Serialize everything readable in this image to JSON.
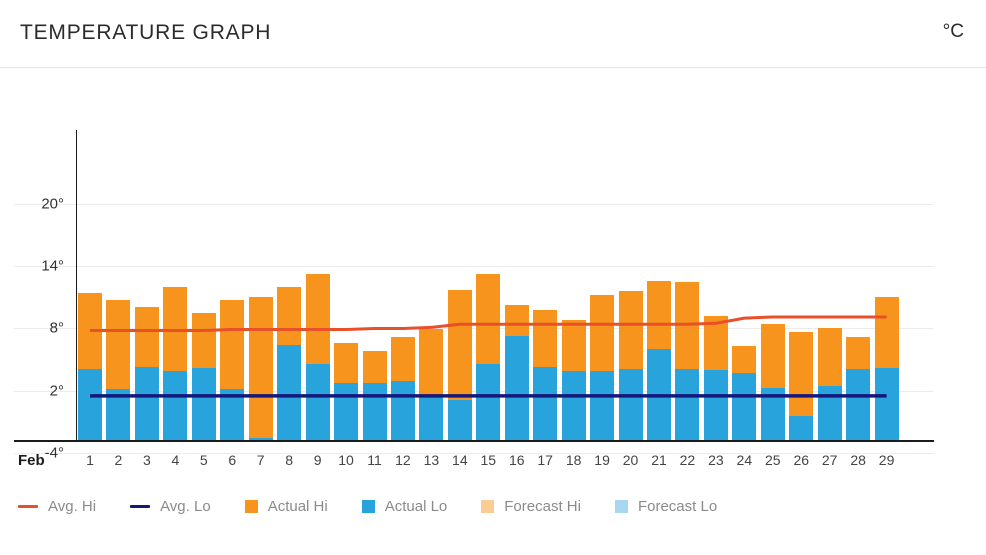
{
  "header": {
    "title": "TEMPERATURE GRAPH",
    "unit": "°C"
  },
  "axis": {
    "month_label": "Feb",
    "y_ticks": [
      "20°",
      "14°",
      "8°",
      "2°",
      "-4°"
    ],
    "x_labels": [
      "1",
      "2",
      "3",
      "4",
      "5",
      "6",
      "7",
      "8",
      "9",
      "10",
      "11",
      "12",
      "13",
      "14",
      "15",
      "16",
      "17",
      "18",
      "19",
      "20",
      "21",
      "22",
      "23",
      "24",
      "25",
      "26",
      "27",
      "28",
      "29"
    ]
  },
  "legend": {
    "items": [
      {
        "label": "Avg. Hi",
        "type": "line",
        "color": "#e8502a"
      },
      {
        "label": "Avg. Lo",
        "type": "line",
        "color": "#16177a"
      },
      {
        "label": "Actual Hi",
        "type": "box",
        "color": "#f7941e"
      },
      {
        "label": "Actual Lo",
        "type": "box",
        "color": "#29a3dc"
      },
      {
        "label": "Forecast Hi",
        "type": "box",
        "color": "#fbcd95"
      },
      {
        "label": "Forecast Lo",
        "type": "box",
        "color": "#a8d8ef"
      }
    ]
  },
  "colors": {
    "actual_hi": "#f7941e",
    "actual_lo": "#29a3dc",
    "forecast_hi": "#fbcd95",
    "forecast_lo": "#a8d8ef",
    "avg_hi": "#e8502a",
    "avg_lo": "#16177a",
    "grid": "#ececec",
    "axis": "#1b1b1b"
  },
  "chart_data": {
    "type": "bar",
    "title": "TEMPERATURE GRAPH",
    "xlabel": "Feb",
    "ylabel": "°C",
    "unit": "°C",
    "grid": true,
    "legend_position": "bottom-left",
    "ylim": [
      -6,
      22
    ],
    "yticks": [
      -4,
      2,
      8,
      14,
      20
    ],
    "categories": [
      "1",
      "2",
      "3",
      "4",
      "5",
      "6",
      "7",
      "8",
      "9",
      "10",
      "11",
      "12",
      "13",
      "14",
      "15",
      "16",
      "17",
      "18",
      "19",
      "20",
      "21",
      "22",
      "23",
      "24",
      "25",
      "26",
      "27",
      "28",
      "29"
    ],
    "series": [
      {
        "name": "Actual Hi",
        "type": "bar",
        "color": "#f7941e",
        "values": [
          11.4,
          10.7,
          10.1,
          12.0,
          9.5,
          10.7,
          11.0,
          12.0,
          13.2,
          6.6,
          5.8,
          7.2,
          7.9,
          11.7,
          13.2,
          10.3,
          9.8,
          8.8,
          11.2,
          11.6,
          12.6,
          12.5,
          9.2,
          6.3,
          8.4,
          7.7,
          8.0,
          7.2,
          11.0
        ]
      },
      {
        "name": "Actual Lo",
        "type": "bar",
        "color": "#29a3dc",
        "values": [
          4.1,
          2.2,
          4.3,
          3.9,
          4.2,
          2.2,
          -2.6,
          6.4,
          4.6,
          2.7,
          2.7,
          2.9,
          1.5,
          1.1,
          4.6,
          7.3,
          4.3,
          3.9,
          3.9,
          4.1,
          6.0,
          4.1,
          4.0,
          3.7,
          2.3,
          -0.4,
          2.5,
          4.1,
          4.2
        ]
      },
      {
        "name": "Avg. Hi",
        "type": "line",
        "color": "#e8502a",
        "values": [
          7.8,
          7.8,
          7.8,
          7.8,
          7.8,
          7.9,
          7.9,
          7.9,
          7.9,
          7.9,
          8.0,
          8.0,
          8.1,
          8.4,
          8.4,
          8.4,
          8.4,
          8.4,
          8.4,
          8.4,
          8.4,
          8.4,
          8.5,
          9.0,
          9.1,
          9.1,
          9.1,
          9.1,
          9.1
        ]
      },
      {
        "name": "Avg. Lo",
        "type": "line",
        "color": "#16177a",
        "values": [
          1.5,
          1.5,
          1.5,
          1.5,
          1.5,
          1.5,
          1.5,
          1.5,
          1.5,
          1.5,
          1.5,
          1.5,
          1.5,
          1.5,
          1.5,
          1.5,
          1.5,
          1.5,
          1.5,
          1.5,
          1.5,
          1.5,
          1.5,
          1.5,
          1.5,
          1.5,
          1.5,
          1.5,
          1.5
        ]
      },
      {
        "name": "Forecast Hi",
        "type": "bar",
        "color": "#fbcd95",
        "values": []
      },
      {
        "name": "Forecast Lo",
        "type": "bar",
        "color": "#a8d8ef",
        "values": []
      }
    ]
  }
}
